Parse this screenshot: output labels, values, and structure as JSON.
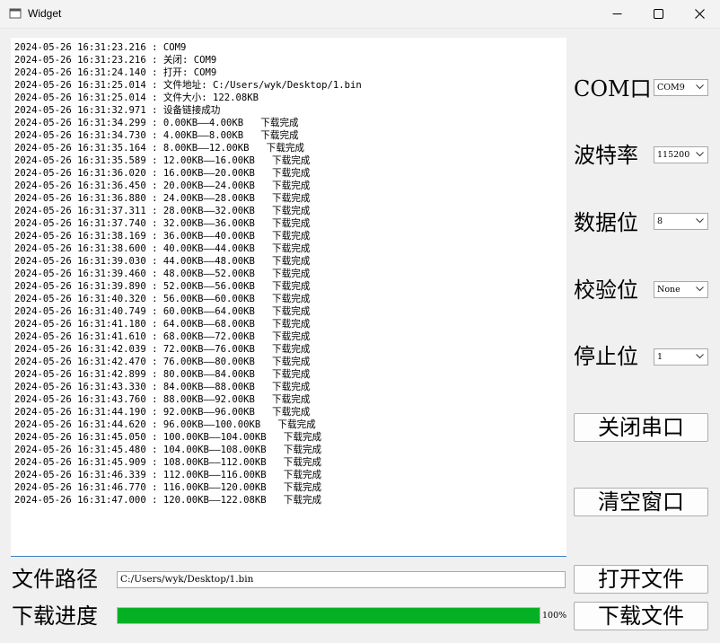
{
  "window": {
    "title": "Widget"
  },
  "log": [
    "2024-05-26 16:31:23.216 : COM9",
    "2024-05-26 16:31:23.216 : 关闭: COM9",
    "2024-05-26 16:31:24.140 : 打开: COM9",
    "2024-05-26 16:31:25.014 : 文件地址: C:/Users/wyk/Desktop/1.bin",
    "2024-05-26 16:31:25.014 : 文件大小: 122.08KB",
    "2024-05-26 16:31:32.971 : 设备链接成功",
    "2024-05-26 16:31:34.299 : 0.00KB——4.00KB   下载完成",
    "2024-05-26 16:31:34.730 : 4.00KB——8.00KB   下载完成",
    "2024-05-26 16:31:35.164 : 8.00KB——12.00KB   下载完成",
    "2024-05-26 16:31:35.589 : 12.00KB——16.00KB   下载完成",
    "2024-05-26 16:31:36.020 : 16.00KB——20.00KB   下载完成",
    "2024-05-26 16:31:36.450 : 20.00KB——24.00KB   下载完成",
    "2024-05-26 16:31:36.880 : 24.00KB——28.00KB   下载完成",
    "2024-05-26 16:31:37.311 : 28.00KB——32.00KB   下载完成",
    "2024-05-26 16:31:37.740 : 32.00KB——36.00KB   下载完成",
    "2024-05-26 16:31:38.169 : 36.00KB——40.00KB   下载完成",
    "2024-05-26 16:31:38.600 : 40.00KB——44.00KB   下载完成",
    "2024-05-26 16:31:39.030 : 44.00KB——48.00KB   下载完成",
    "2024-05-26 16:31:39.460 : 48.00KB——52.00KB   下载完成",
    "2024-05-26 16:31:39.890 : 52.00KB——56.00KB   下载完成",
    "2024-05-26 16:31:40.320 : 56.00KB——60.00KB   下载完成",
    "2024-05-26 16:31:40.749 : 60.00KB——64.00KB   下载完成",
    "2024-05-26 16:31:41.180 : 64.00KB——68.00KB   下载完成",
    "2024-05-26 16:31:41.610 : 68.00KB——72.00KB   下载完成",
    "2024-05-26 16:31:42.039 : 72.00KB——76.00KB   下载完成",
    "2024-05-26 16:31:42.470 : 76.00KB——80.00KB   下载完成",
    "2024-05-26 16:31:42.899 : 80.00KB——84.00KB   下载完成",
    "2024-05-26 16:31:43.330 : 84.00KB——88.00KB   下载完成",
    "2024-05-26 16:31:43.760 : 88.00KB——92.00KB   下载完成",
    "2024-05-26 16:31:44.190 : 92.00KB——96.00KB   下载完成",
    "2024-05-26 16:31:44.620 : 96.00KB——100.00KB   下载完成",
    "2024-05-26 16:31:45.050 : 100.00KB——104.00KB   下载完成",
    "2024-05-26 16:31:45.480 : 104.00KB——108.00KB   下载完成",
    "2024-05-26 16:31:45.909 : 108.00KB——112.00KB   下载完成",
    "2024-05-26 16:31:46.339 : 112.00KB——116.00KB   下载完成",
    "2024-05-26 16:31:46.770 : 116.00KB——120.00KB   下载完成",
    "2024-05-26 16:31:47.000 : 120.00KB——122.08KB   下载完成"
  ],
  "serial": {
    "com_label": "COM口",
    "com_value": "COM9",
    "baud_label": "波特率",
    "baud_value": "115200",
    "data_label": "数据位",
    "data_value": "8",
    "parity_label": "校验位",
    "parity_value": "None",
    "stop_label": "停止位",
    "stop_value": "1"
  },
  "buttons": {
    "close_port": "关闭串口",
    "clear_window": "清空窗口",
    "open_file": "打开文件",
    "download_file": "下载文件"
  },
  "file": {
    "label": "文件路径",
    "path": "C:/Users/wyk/Desktop/1.bin"
  },
  "progress": {
    "label": "下载进度",
    "value": 100,
    "text": "100%",
    "color": "#06b025"
  }
}
